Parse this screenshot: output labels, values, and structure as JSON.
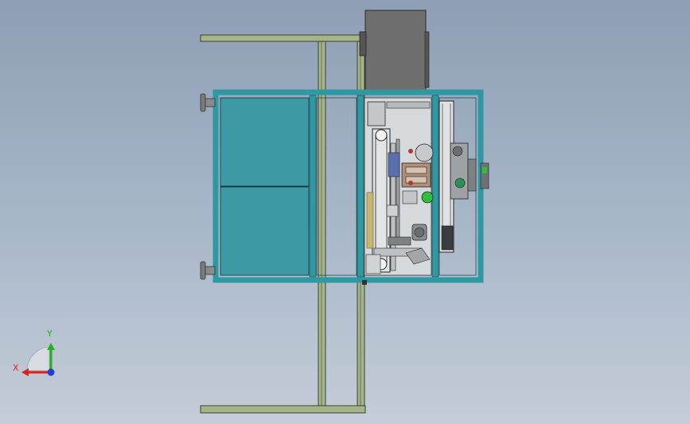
{
  "scene": {
    "colors": {
      "frame_green": "#a6b48a",
      "frame_green_edge": "#394232",
      "teal_panel": "#3d9aa5",
      "teal_frame": "#2e98a3",
      "motor_box": "#6e6e6e",
      "machinery_fill": "#c9cccf",
      "accent_green": "#2fbf3a",
      "accent_red": "#b23a2a"
    }
  },
  "triad": {
    "x_label": "X",
    "y_label": "Y",
    "x_color": "#e0201a",
    "y_color": "#20b020",
    "z_color": "#1f3fd0"
  }
}
